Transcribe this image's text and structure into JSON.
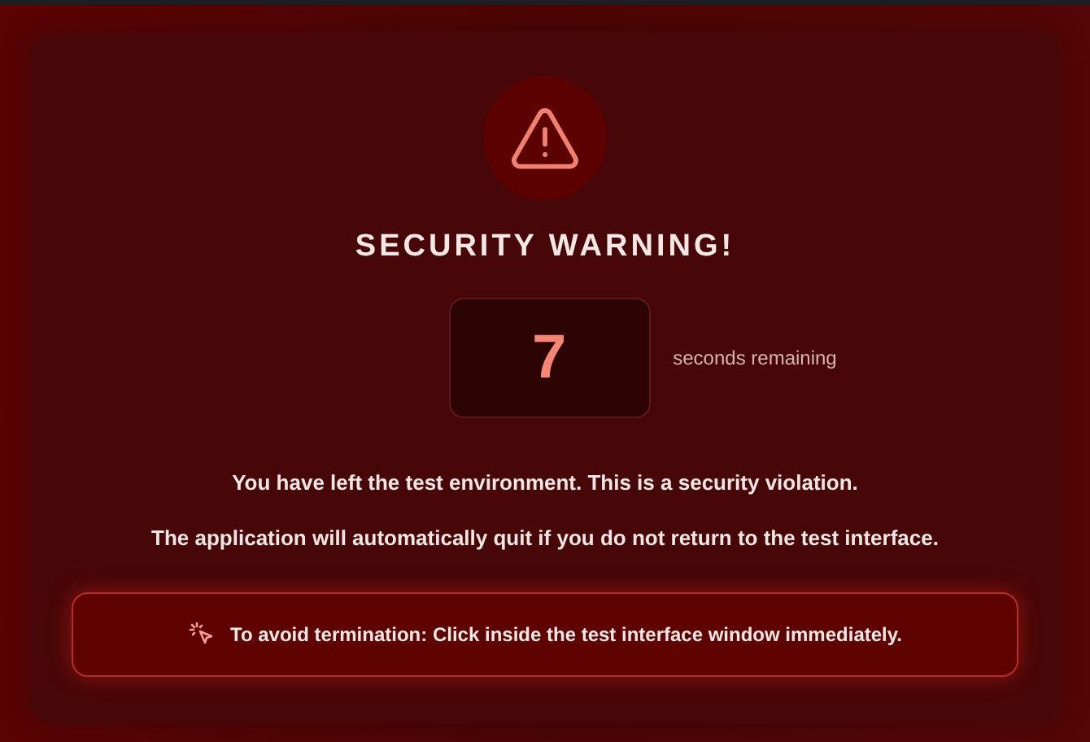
{
  "title": "SECURITY WARNING!",
  "countdown": {
    "value": "7",
    "label": "seconds remaining"
  },
  "messages": [
    "You have left the test environment. This is a security violation.",
    "The application will automatically quit if you do not return to the test interface."
  ],
  "notice": {
    "text": "To avoid termination: Click inside the test interface window immediately."
  }
}
